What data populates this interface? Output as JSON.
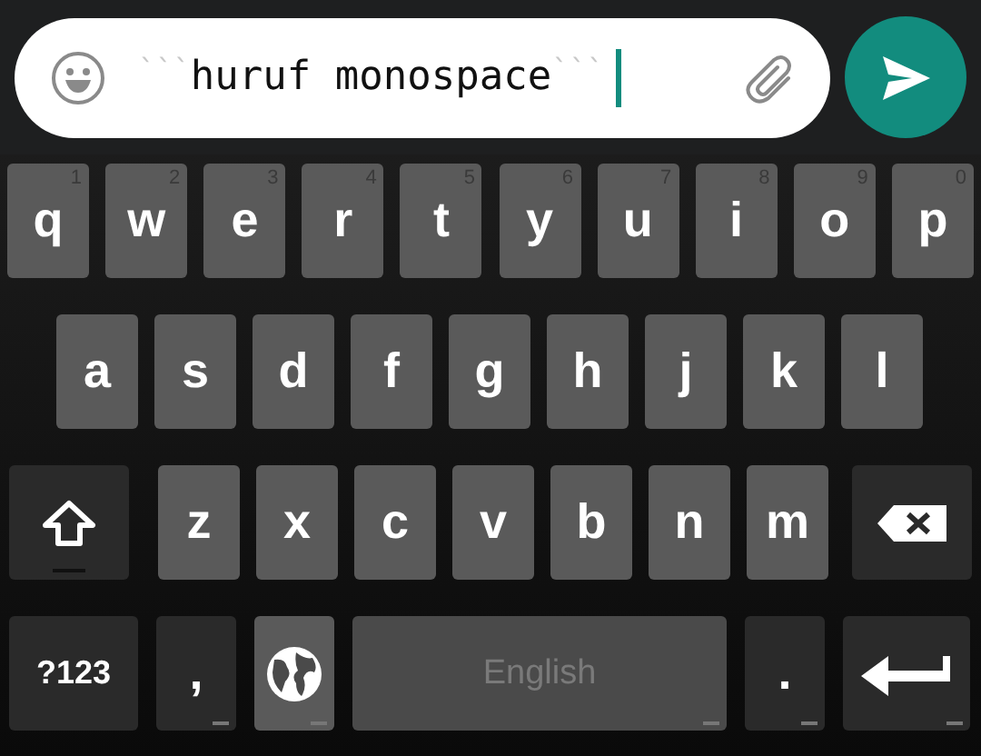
{
  "composer": {
    "markup_open": "```",
    "text": "huruf monospace",
    "markup_close": "```"
  },
  "keyboard": {
    "rows": [
      [
        {
          "kind": "letter",
          "label": "q",
          "hint": "1"
        },
        {
          "kind": "letter",
          "label": "w",
          "hint": "2"
        },
        {
          "kind": "letter",
          "label": "e",
          "hint": "3"
        },
        {
          "kind": "letter",
          "label": "r",
          "hint": "4"
        },
        {
          "kind": "letter",
          "label": "t",
          "hint": "5"
        },
        {
          "kind": "letter",
          "label": "y",
          "hint": "6"
        },
        {
          "kind": "letter",
          "label": "u",
          "hint": "7"
        },
        {
          "kind": "letter",
          "label": "i",
          "hint": "8"
        },
        {
          "kind": "letter",
          "label": "o",
          "hint": "9"
        },
        {
          "kind": "letter",
          "label": "p",
          "hint": "0"
        }
      ],
      [
        {
          "kind": "letter",
          "label": "a"
        },
        {
          "kind": "letter",
          "label": "s"
        },
        {
          "kind": "letter",
          "label": "d"
        },
        {
          "kind": "letter",
          "label": "f"
        },
        {
          "kind": "letter",
          "label": "g"
        },
        {
          "kind": "letter",
          "label": "h"
        },
        {
          "kind": "letter",
          "label": "j"
        },
        {
          "kind": "letter",
          "label": "k"
        },
        {
          "kind": "letter",
          "label": "l"
        }
      ],
      [
        {
          "kind": "shift"
        },
        {
          "kind": "letter",
          "label": "z"
        },
        {
          "kind": "letter",
          "label": "x"
        },
        {
          "kind": "letter",
          "label": "c"
        },
        {
          "kind": "letter",
          "label": "v"
        },
        {
          "kind": "letter",
          "label": "b"
        },
        {
          "kind": "letter",
          "label": "n"
        },
        {
          "kind": "letter",
          "label": "m"
        },
        {
          "kind": "backspace"
        }
      ]
    ],
    "bottom_row": [
      {
        "kind": "symbols",
        "label": "?123"
      },
      {
        "kind": "punct",
        "label": ","
      },
      {
        "kind": "globe"
      },
      {
        "kind": "space",
        "label": "English"
      },
      {
        "kind": "punct",
        "label": "."
      },
      {
        "kind": "enter"
      }
    ]
  }
}
